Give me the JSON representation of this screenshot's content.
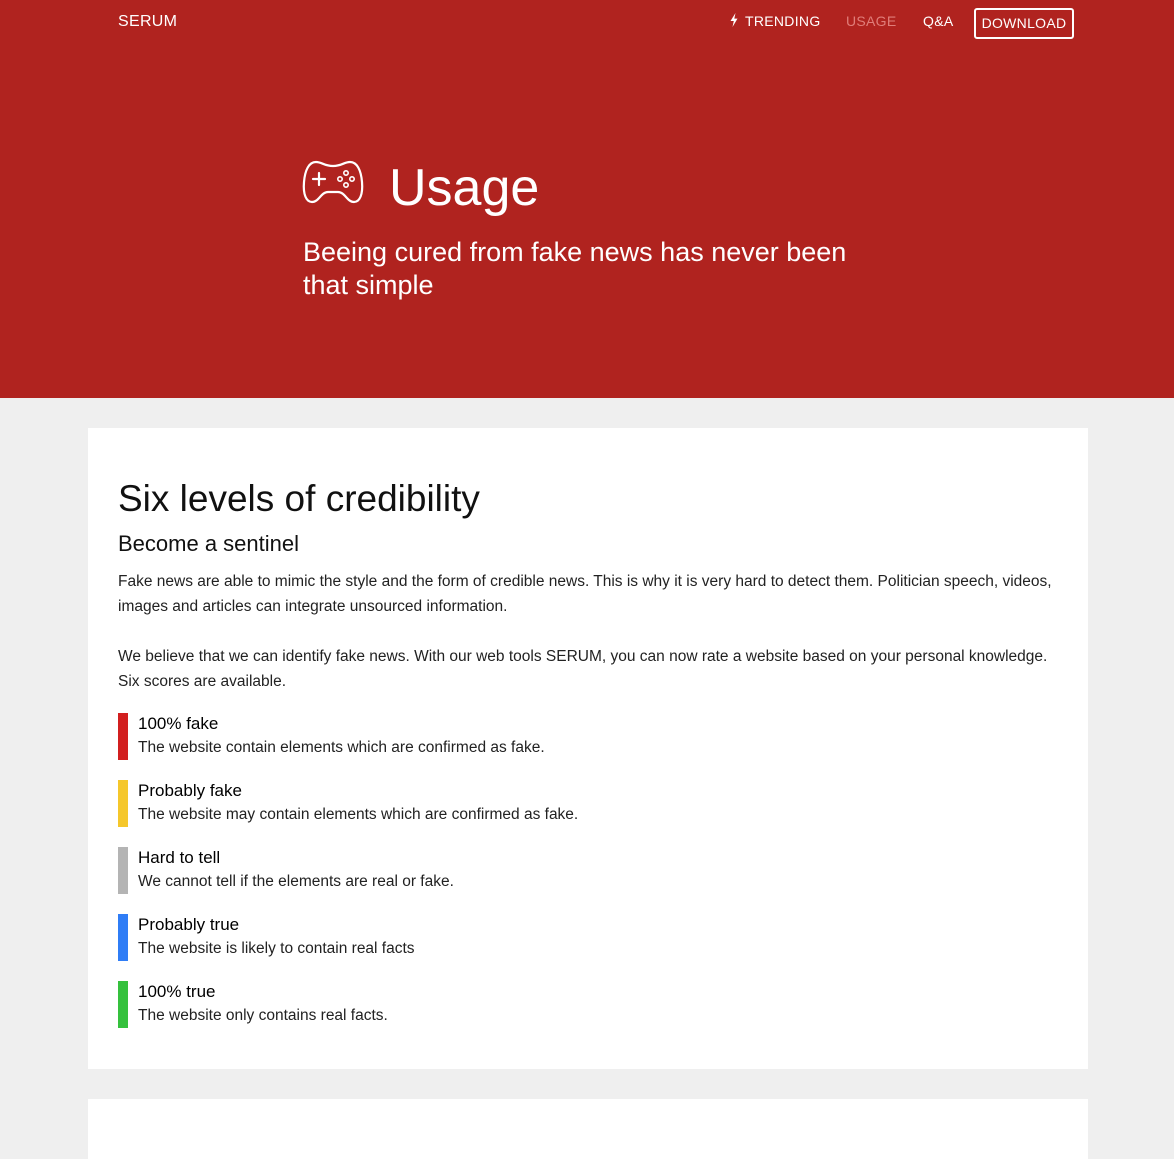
{
  "header": {
    "brand": "SERUM",
    "nav": {
      "trending": "TRENDING",
      "trending_icon": "lightning-bolt-icon",
      "usage": "USAGE",
      "qa": "Q&A",
      "download": "DOWNLOAD"
    },
    "colors": {
      "background": "#b0231f",
      "active_nav": "#e07d79"
    }
  },
  "hero": {
    "icon": "gamepad-icon",
    "title": "Usage",
    "subtitle": "Beeing cured from fake news has never been that simple"
  },
  "main": {
    "title": "Six levels of credibility",
    "subtitle": "Become a sentinel",
    "paragraph1": "Fake news are able to mimic the style and the form of credible news. This is why it is very hard to detect them. Politician speech, videos, images and articles can integrate unsourced information.",
    "paragraph2": "We believe that we can identify fake news. With our web tools SERUM, you can now rate a website based on your personal knowledge. Six scores are available.",
    "levels": [
      {
        "name": "100% fake",
        "description": "The website contain elements which are confirmed as fake.",
        "color": "#d21f1f"
      },
      {
        "name": "Probably fake",
        "description": "The website may contain elements which are confirmed as fake.",
        "color": "#f5c72b"
      },
      {
        "name": "Hard to tell",
        "description": "We cannot tell if the elements are real or fake.",
        "color": "#b4b4b4"
      },
      {
        "name": "Probably true",
        "description": "The website is likely to contain real facts",
        "color": "#2f7df6"
      },
      {
        "name": "100% true",
        "description": "The website only contains real facts.",
        "color": "#35c13d"
      }
    ]
  }
}
